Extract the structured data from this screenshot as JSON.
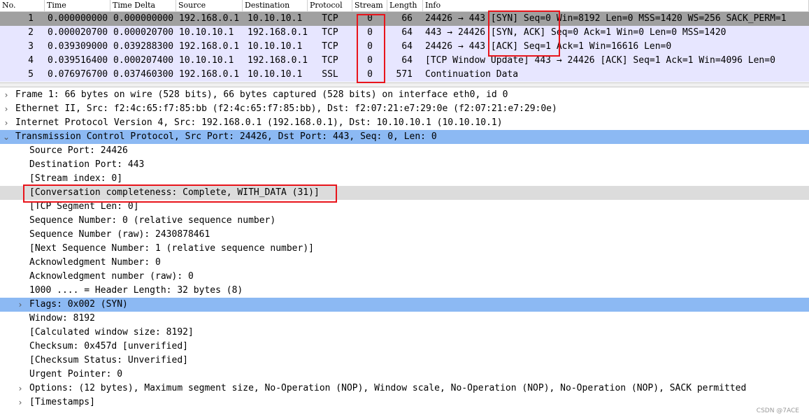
{
  "packet_list": {
    "columns": [
      "No.",
      "Time",
      "Time Delta",
      "Source",
      "Destination",
      "Protocol",
      "Stream",
      "Length",
      "Info"
    ],
    "rows": [
      {
        "no": "1",
        "time": "0.000000000",
        "delta": "0.000000000",
        "src": "192.168.0.1",
        "dst": "10.10.10.1",
        "proto": "TCP",
        "stream": "0",
        "len": "66",
        "info": "24426 → 443 [SYN] Seq=0 Win=8192 Len=0 MSS=1420 WS=256 SACK_PERM=1"
      },
      {
        "no": "2",
        "time": "0.000020700",
        "delta": "0.000020700",
        "src": "10.10.10.1",
        "dst": "192.168.0.1",
        "proto": "TCP",
        "stream": "0",
        "len": "64",
        "info": "443 → 24426 [SYN, ACK] Seq=0 Ack=1 Win=0 Len=0 MSS=1420"
      },
      {
        "no": "3",
        "time": "0.039309000",
        "delta": "0.039288300",
        "src": "192.168.0.1",
        "dst": "10.10.10.1",
        "proto": "TCP",
        "stream": "0",
        "len": "64",
        "info": "24426 → 443 [ACK] Seq=1 Ack=1 Win=16616 Len=0"
      },
      {
        "no": "4",
        "time": "0.039516400",
        "delta": "0.000207400",
        "src": "10.10.10.1",
        "dst": "192.168.0.1",
        "proto": "TCP",
        "stream": "0",
        "len": "64",
        "info": "[TCP Window Update] 443 → 24426 [ACK] Seq=1 Ack=1 Win=4096 Len=0"
      },
      {
        "no": "5",
        "time": "0.076976700",
        "delta": "0.037460300",
        "src": "192.168.0.1",
        "dst": "10.10.10.1",
        "proto": "SSL",
        "stream": "0",
        "len": "571",
        "info": "Continuation Data"
      }
    ],
    "colors": {
      "selected_row": "#a0a0a0",
      "tcp_row": "#e7e6ff",
      "ssl_row": "#e7e6ff"
    }
  },
  "details": [
    {
      "text": "Frame 1: 66 bytes on wire (528 bits), 66 bytes captured (528 bits) on interface eth0, id 0",
      "expander": "collapsed"
    },
    {
      "text": "Ethernet II, Src: f2:4c:65:f7:85:bb (f2:4c:65:f7:85:bb), Dst: f2:07:21:e7:29:0e (f2:07:21:e7:29:0e)",
      "expander": "collapsed"
    },
    {
      "text": "Internet Protocol Version 4, Src: 192.168.0.1 (192.168.0.1), Dst: 10.10.10.1 (10.10.10.1)",
      "expander": "collapsed"
    },
    {
      "text": "Transmission Control Protocol, Src Port: 24426, Dst Port: 443, Seq: 0, Len: 0",
      "expander": "expanded",
      "state": "selected"
    },
    {
      "text": "Source Port: 24426"
    },
    {
      "text": "Destination Port: 443"
    },
    {
      "text": "[Stream index: 0]"
    },
    {
      "text": "[Conversation completeness: Complete, WITH_DATA (31)]",
      "state": "hover"
    },
    {
      "text": "[TCP Segment Len: 0]"
    },
    {
      "text": "Sequence Number: 0    (relative sequence number)"
    },
    {
      "text": "Sequence Number (raw): 2430878461"
    },
    {
      "text": "[Next Sequence Number: 1    (relative sequence number)]"
    },
    {
      "text": "Acknowledgment Number: 0"
    },
    {
      "text": "Acknowledgment number (raw): 0"
    },
    {
      "text": "1000 .... = Header Length: 32 bytes (8)"
    },
    {
      "text": "Flags: 0x002 (SYN)",
      "expander": "collapsed",
      "state": "selected"
    },
    {
      "text": "Window: 8192"
    },
    {
      "text": "[Calculated window size: 8192]"
    },
    {
      "text": "Checksum: 0x457d [unverified]"
    },
    {
      "text": "[Checksum Status: Unverified]"
    },
    {
      "text": "Urgent Pointer: 0"
    },
    {
      "text": "Options: (12 bytes), Maximum segment size, No-Operation (NOP), Window scale, No-Operation (NOP), No-Operation (NOP), SACK permitted",
      "expander": "collapsed"
    },
    {
      "text": "[Timestamps]",
      "expander": "collapsed"
    }
  ],
  "icons": {
    "collapsed": "chevron-right-icon",
    "expanded": "chevron-down-icon"
  },
  "annotation_color": "#e8141b",
  "watermark": "CSDN @7ACE"
}
